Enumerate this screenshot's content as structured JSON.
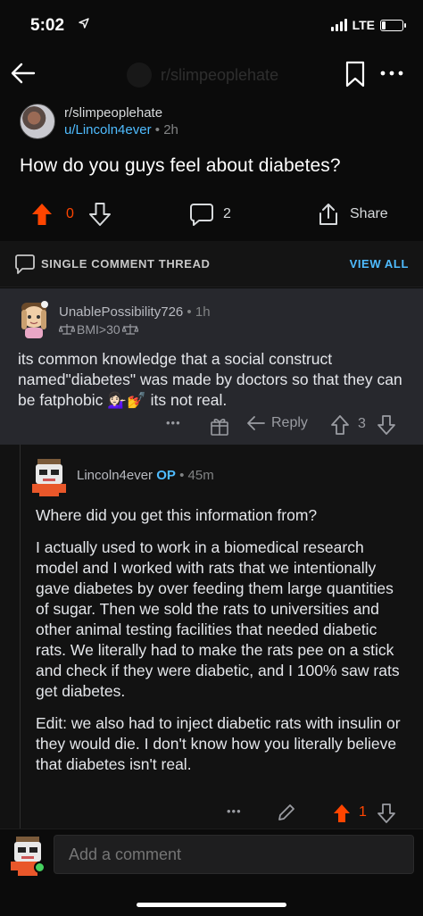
{
  "status_bar": {
    "time": "5:02",
    "network": "LTE",
    "battery_level": 0.2
  },
  "nav": {
    "title": "r/slimpeoplehate"
  },
  "post": {
    "subreddit": "r/slimpeoplehate",
    "author": "u/Lincoln4ever",
    "separator": "•",
    "age": "2h",
    "title": "How do you guys feel about diabetes?",
    "score": "0",
    "comments": "2",
    "share_label": "Share",
    "colors": {
      "upvote": "#ff4500"
    }
  },
  "thread_bar": {
    "label": "SINGLE COMMENT THREAD",
    "view_all": "VIEW ALL"
  },
  "comment_parent": {
    "username": "UnablePossibility726",
    "separator": "•",
    "age": "1h",
    "flair": "BMI>30",
    "body": "its common knowledge that a social construct named\"diabetes\" was made by doctors so that they can be fatphobic 💁🏻‍♀️💅 its not real.",
    "more": "•••",
    "reply_label": "Reply",
    "score": "3"
  },
  "comment_reply": {
    "username": "Lincoln4ever",
    "op_badge": "OP",
    "separator": "•",
    "age": "45m",
    "paragraphs": [
      "Where did you get this information from?",
      "I actually used to work in a biomedical research model and I worked with rats that we intentionally gave diabetes by over feeding them large quantities of sugar. Then we sold the rats to universities and other animal testing facilities that needed diabetic rats. We literally had to make the rats pee on a stick and check if they were diabetic, and I 100% saw rats get diabetes.",
      "Edit: we also had to inject diabetic rats with insulin or they would die. I don't know how you literally believe that diabetes isn't real."
    ],
    "more": "•••",
    "score": "1",
    "colors": {
      "upvote": "#ff4500"
    }
  },
  "composer": {
    "placeholder": "Add a comment"
  }
}
